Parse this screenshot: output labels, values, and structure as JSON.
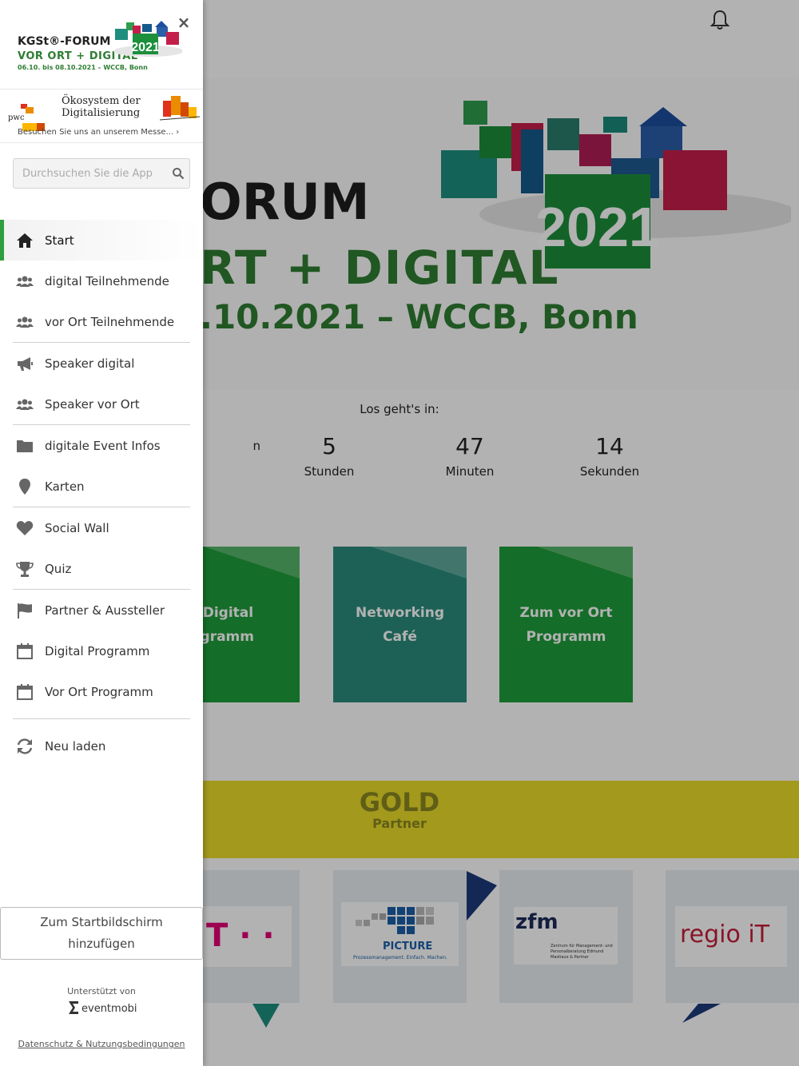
{
  "colors": {
    "accent": "#2e9e3e",
    "brand_green": "#2e7d32",
    "tile_green": "#1e9c3a",
    "tile_teal": "#2a8c7c",
    "gold_yellow": "#e8dc2a"
  },
  "drawer": {
    "brand": {
      "name": "KGSt®-FORUM",
      "tagline": "VOR ORT + DIGITAL",
      "dates": "06.10. bis 08.10.2021 – WCCB, Bonn",
      "cube_year": "2021"
    },
    "close_icon": "close-icon",
    "close_label": "×",
    "banner": {
      "logo_text": "pwc",
      "text": "Ökosystem der Digitalisierung",
      "link": "Besuchen Sie uns an unserem Messe... ›"
    },
    "search": {
      "placeholder": "Durchsuchen Sie die App",
      "value": ""
    },
    "menu": [
      {
        "label": "Start",
        "icon": "home-icon",
        "active": true
      },
      {
        "label": "digital Teilnehmende",
        "icon": "users-icon"
      },
      {
        "label": "vor Ort Teilnehmende",
        "icon": "users-icon"
      },
      {
        "label": "Speaker digital",
        "icon": "megaphone-icon"
      },
      {
        "label": "Speaker vor Ort",
        "icon": "users-icon"
      },
      {
        "label": "digitale Event Infos",
        "icon": "folder-icon"
      },
      {
        "label": "Karten",
        "icon": "map-pin-icon"
      },
      {
        "label": "Social Wall",
        "icon": "heart-icon"
      },
      {
        "label": "Quiz",
        "icon": "trophy-icon"
      },
      {
        "label": "Partner & Aussteller",
        "icon": "flag-icon"
      },
      {
        "label": "Digital Programm",
        "icon": "calendar-icon"
      },
      {
        "label": "Vor Ort Programm",
        "icon": "calendar-icon"
      },
      {
        "label": "Neu laden",
        "icon": "refresh-icon"
      }
    ],
    "add_home_line1": "Zum Startbildschirm",
    "add_home_line2": "hinzufügen",
    "powered_by": "Unterstützt von",
    "eventmobi": "eventmobi",
    "privacy": "Datenschutz & Nutzungsbedingungen"
  },
  "main": {
    "hero": {
      "line1": "ORUM",
      "line2": "RT + DIGITAL",
      "line3": ".10.2021 – WCCB, Bonn",
      "cube_year": "2021"
    },
    "countdown": {
      "title": "Los geht's in:",
      "items": [
        {
          "value": "",
          "unit": "n"
        },
        {
          "value": "5",
          "unit": "Stunden"
        },
        {
          "value": "47",
          "unit": "Minuten"
        },
        {
          "value": "14",
          "unit": "Sekunden"
        }
      ]
    },
    "tiles": [
      {
        "label": "um Digital Programm"
      },
      {
        "label": "Networking Café"
      },
      {
        "label": "Zum vor Ort Programm"
      }
    ],
    "gold": {
      "title": "GOLD",
      "subtitle": "Partner"
    },
    "sponsors": [
      {
        "text": "T · ·"
      },
      {
        "text": "PICTURE",
        "sub": "Prozessmanagement. Einfach. Machen."
      },
      {
        "text": "zfm",
        "sub": "Zentrum für Management- und Personalberatung Edmund Mastiaux & Partner"
      },
      {
        "text": "regio iT"
      }
    ]
  },
  "icons": {
    "bell": "bell-icon",
    "profile": "avatar-icon",
    "search": "search-icon"
  }
}
